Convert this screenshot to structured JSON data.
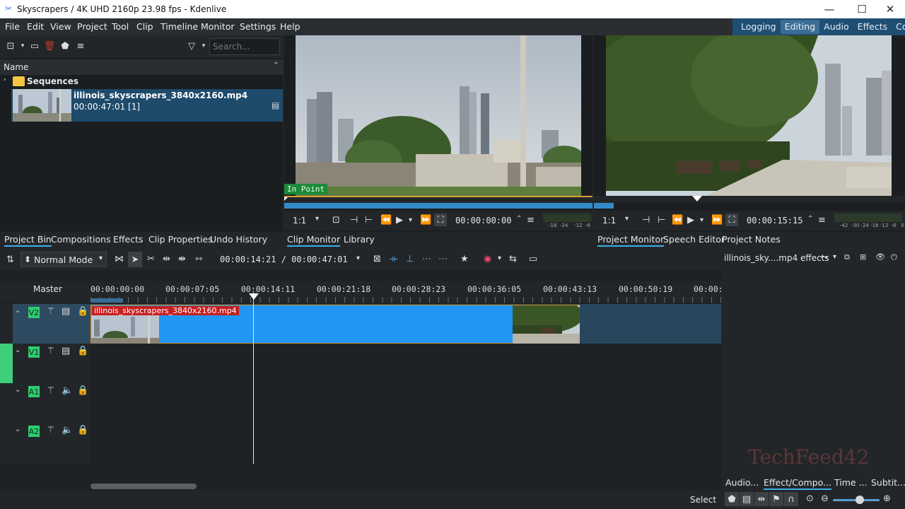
{
  "window": {
    "title": "Skyscrapers / 4K UHD 2160p 23.98 fps - Kdenlive",
    "minimize": "—",
    "maximize": "☐",
    "close": "✕"
  },
  "menu": [
    "File",
    "Edit",
    "View",
    "Project",
    "Tool",
    "Clip",
    "Timeline",
    "Monitor",
    "Settings",
    "Help"
  ],
  "layouts": [
    "Logging",
    "Editing",
    "Audio",
    "Effects",
    "Color"
  ],
  "bin": {
    "search_placeholder": "Search...",
    "column_name": "Name",
    "folder": "Sequences",
    "clip_name": "illinois_skyscrapers_3840x2160.mp4",
    "clip_info": "00:00:47:01 [1]",
    "tabs": [
      "Project Bin",
      "Compositions",
      "Effects",
      "Clip Properties",
      "Undo History"
    ]
  },
  "clip_monitor": {
    "zoom": "1:1",
    "timecode": "00:00:00:00",
    "in_point_label": "In Point",
    "meter_ticks": "-18  -24    -12  -6   0",
    "tabs": [
      "Clip Monitor",
      "Library"
    ]
  },
  "project_monitor": {
    "zoom": "1:1",
    "timecode": "00:00:15:15",
    "meter_ticks": "-42  -30 -24 -18 -12  -6   0",
    "tabs": [
      "Project Monitor",
      "Speech Editor",
      "Project Notes"
    ]
  },
  "timeline": {
    "mode": "Normal Mode",
    "position": "00:00:14:21 / 00:00:47:01",
    "master_label": "Master",
    "ruler": [
      "00:00:00:00",
      "00:00:07:05",
      "00:00:14:11",
      "00:00:21:18",
      "00:00:28:23",
      "00:00:36:05",
      "00:00:43:13",
      "00:00:50:19",
      "00:00:5"
    ],
    "tracks": [
      {
        "name": "V2"
      },
      {
        "name": "V1"
      },
      {
        "name": "A1"
      },
      {
        "name": "A2"
      }
    ],
    "clip_label": "illinois_skyscrapers_3840x2160.mp4"
  },
  "effects_panel": {
    "title": "illinois_sky....mp4 effects",
    "tabs": [
      "Audio...",
      "Effect/Compo...",
      "Time ...",
      "Subtit..."
    ]
  },
  "statusbar": {
    "tool": "Select"
  },
  "watermark": "TechFeed42",
  "colors": {
    "accent": "#3daee9",
    "clip_blue": "#2196f3",
    "track_green": "#2ecc71",
    "clip_label_red": "#c81e1e"
  }
}
